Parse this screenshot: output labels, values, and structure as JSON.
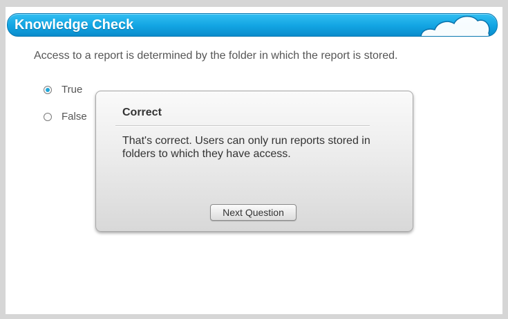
{
  "header": {
    "title": "Knowledge Check"
  },
  "question": {
    "text": "Access to a report is determined by the folder in which the report is stored."
  },
  "options": [
    {
      "label": "True",
      "selected": true
    },
    {
      "label": "False",
      "selected": false
    }
  ],
  "feedback": {
    "title": "Correct",
    "message": "That's correct. Users can only run reports stored in folders to which they have access.",
    "button_label": "Next Question"
  },
  "colors": {
    "header_blue": "#12a4e2",
    "radio_selected": "#1fa6d8"
  }
}
